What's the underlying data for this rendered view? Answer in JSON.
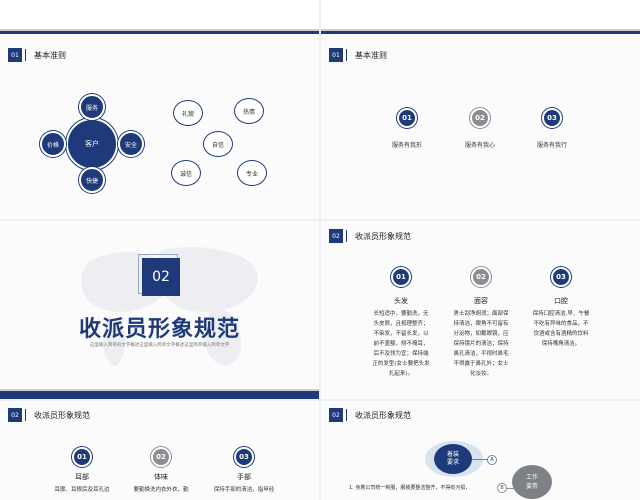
{
  "slide1": {
    "num": "01",
    "title": "基本准则",
    "center": "客户",
    "satellites": [
      "服务",
      "价格",
      "安全",
      "快捷"
    ],
    "outline_circles": [
      "礼貌",
      "热情",
      "自信",
      "诚信",
      "专业"
    ]
  },
  "slide2": {
    "num": "01",
    "title": "基本准则",
    "items": [
      {
        "num": "01",
        "label": "服务有我形"
      },
      {
        "num": "02",
        "label": "服务有我心"
      },
      {
        "num": "03",
        "label": "服务有我行"
      }
    ]
  },
  "slide3": {
    "num": "02",
    "title": "收派员形象规范",
    "subtitle": "这里输入简单的文字概述这里输入简单文字概述这里简单输入简单文字"
  },
  "slide4": {
    "num": "02",
    "title": "收派员形象规范",
    "items": [
      {
        "num": "01",
        "head": "头发",
        "lines": [
          "长短适中，要勤洗，无",
          "头皮屑，且梳理整齐；",
          "不染发，不留长发，以",
          "前不盖额，侧不掩耳，",
          "后不及领为宜；保持端",
          "正的发型(女士要把头发",
          "扎起来)。"
        ]
      },
      {
        "num": "02",
        "head": "面容",
        "lines": [
          "男士刮净胡须；面部保",
          "持清洁，眼角不可留有",
          "分泌物，如戴眼镜，应",
          "保持镜片的清洁；保持",
          "鼻孔清洁，平视时鼻毛",
          "不得露于鼻孔外；女士",
          "化淡妆。"
        ]
      },
      {
        "num": "03",
        "head": "口腔",
        "lines": [
          "保持口腔清洁,早、午餐",
          "不吃有异味的食品，不",
          "饮酒或含有酒精的饮料",
          "保持嘴角清洁。"
        ]
      }
    ]
  },
  "slide5": {
    "num": "02",
    "title": "收派员形象规范",
    "items": [
      {
        "num": "01",
        "head": "耳部",
        "lines": [
          "耳廓、耳根后及耳孔边"
        ]
      },
      {
        "num": "02",
        "head": "体味",
        "lines": [
          "要勤换洗内衣外衣，勤"
        ]
      },
      {
        "num": "03",
        "head": "手部",
        "lines": [
          "保持手部的清洁，指甲经"
        ]
      }
    ]
  },
  "slide6": {
    "num": "02",
    "title": "收派员形象规范",
    "bubble1": [
      "着装",
      "要求"
    ],
    "marker_a": "A",
    "marker_b": "B",
    "bubble2": [
      "工作",
      "姿势"
    ],
    "line1": "1.  身着公司统一制服，服装要整洁整齐，不得有污损，"
  }
}
